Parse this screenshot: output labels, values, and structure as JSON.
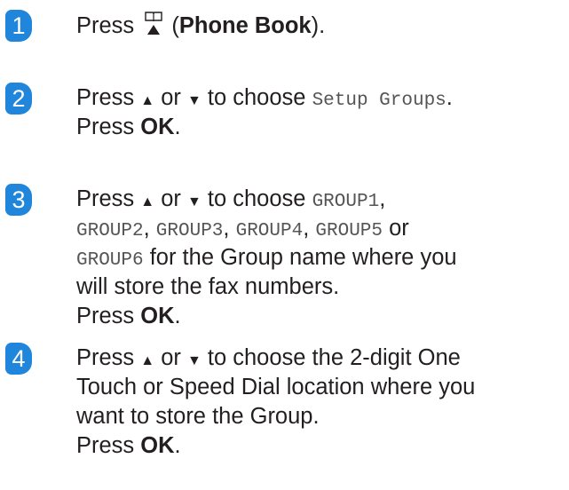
{
  "steps": [
    {
      "number": "1",
      "line1": {
        "a": "Press ",
        "b": " (",
        "bold": "Phone Book",
        "c": ")."
      }
    },
    {
      "number": "2",
      "line1": {
        "a": "Press ",
        "up": "▲",
        "or": " or ",
        "down": "▼",
        "b": " to choose ",
        "mono": "Setup Groups",
        "c": "."
      },
      "line2": {
        "a": "Press ",
        "bold": "OK",
        "c": "."
      }
    },
    {
      "number": "3",
      "line1": {
        "a": "Press ",
        "up": "▲",
        "or": " or ",
        "down": "▼",
        "b": " to choose ",
        "mono": "GROUP1",
        "c": ","
      },
      "line2": {
        "m1": "GROUP2",
        "s1": ", ",
        "m2": "GROUP3",
        "s2": ", ",
        "m3": "GROUP4",
        "s3": ", ",
        "m4": "GROUP5",
        "s4": " or"
      },
      "line3": {
        "m1": "GROUP6",
        "t": " for the Group name where you"
      },
      "line4": "will store the fax numbers.",
      "line5": {
        "a": "Press ",
        "bold": "OK",
        "c": "."
      }
    },
    {
      "number": "4",
      "line1": {
        "a": "Press ",
        "up": "▲",
        "or": " or ",
        "down": "▼",
        "b": " to choose the 2-digit One"
      },
      "line2": "Touch or Speed Dial location where you",
      "line3": "want to store the Group.",
      "line4": {
        "a": "Press ",
        "bold": "OK",
        "c": "."
      }
    }
  ],
  "icons": {
    "phone_book": "phone-book-icon"
  },
  "colors": {
    "step_badge": "#1f86dc",
    "text": "#231f20",
    "mono_text": "#555558"
  }
}
